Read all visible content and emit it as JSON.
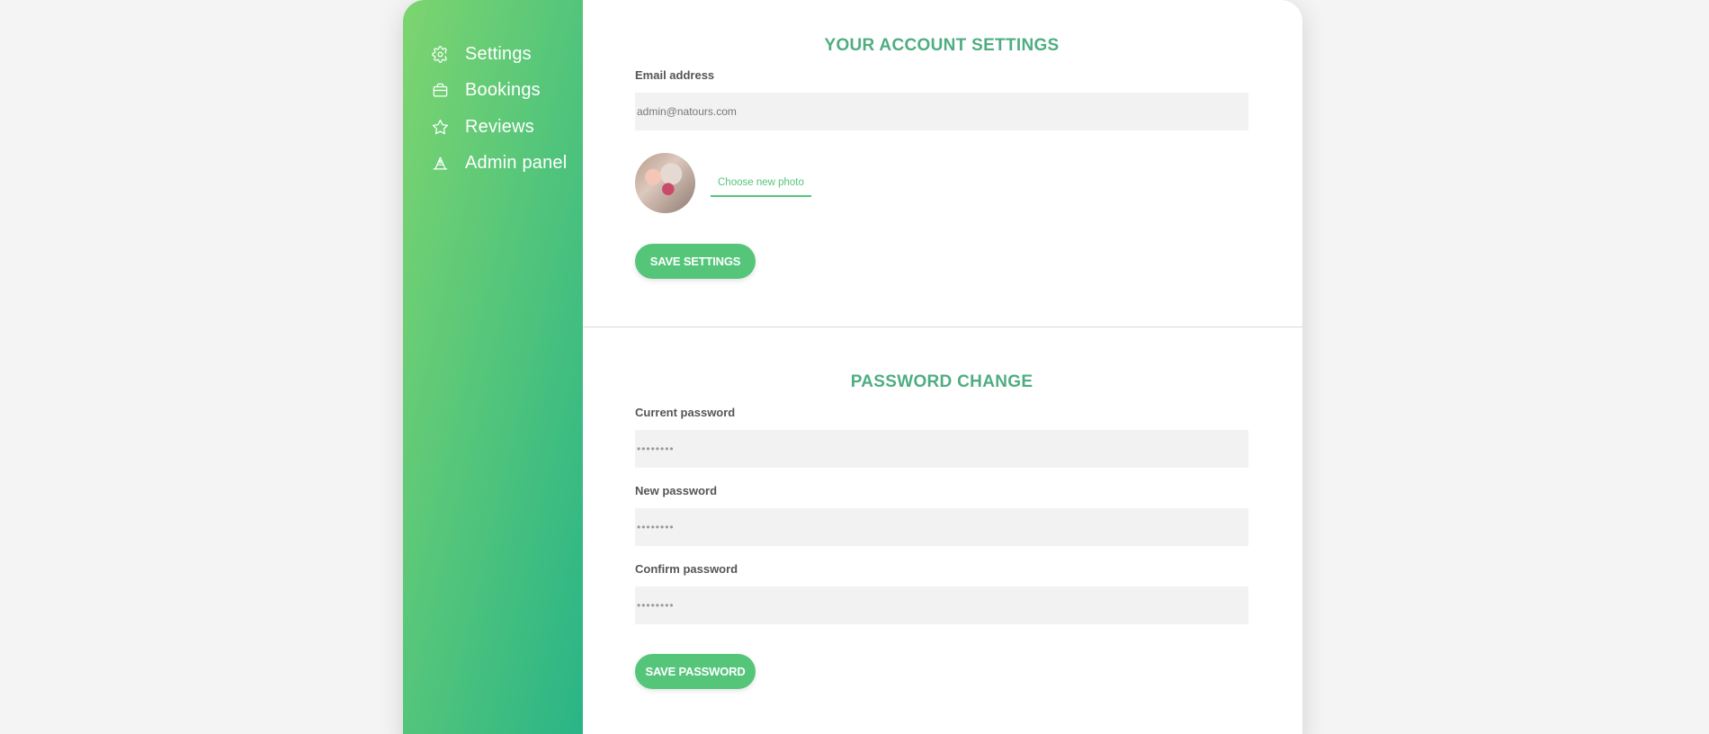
{
  "nav": {
    "items": [
      {
        "label": "Settings",
        "icon": "settings-icon"
      },
      {
        "label": "Bookings",
        "icon": "briefcase-icon"
      },
      {
        "label": "Reviews",
        "icon": "star-icon"
      },
      {
        "label": "Admin panel",
        "icon": "admin-icon"
      }
    ]
  },
  "account": {
    "title": "YOUR ACCOUNT SETTINGS",
    "email_label": "Email address",
    "email_value": "admin@natours.com",
    "photo_link": "Choose new photo",
    "save_label": "SAVE SETTINGS"
  },
  "password": {
    "title": "PASSWORD CHANGE",
    "current_label": "Current password",
    "current_placeholder": "••••••••",
    "new_label": "New password",
    "new_placeholder": "••••••••",
    "confirm_label": "Confirm password",
    "confirm_placeholder": "••••••••",
    "save_label": "SAVE PASSWORD"
  },
  "colors": {
    "accent": "#55c57a",
    "heading": "#4fad81",
    "gradient_start": "#7dd56f",
    "gradient_end": "#28b487"
  }
}
